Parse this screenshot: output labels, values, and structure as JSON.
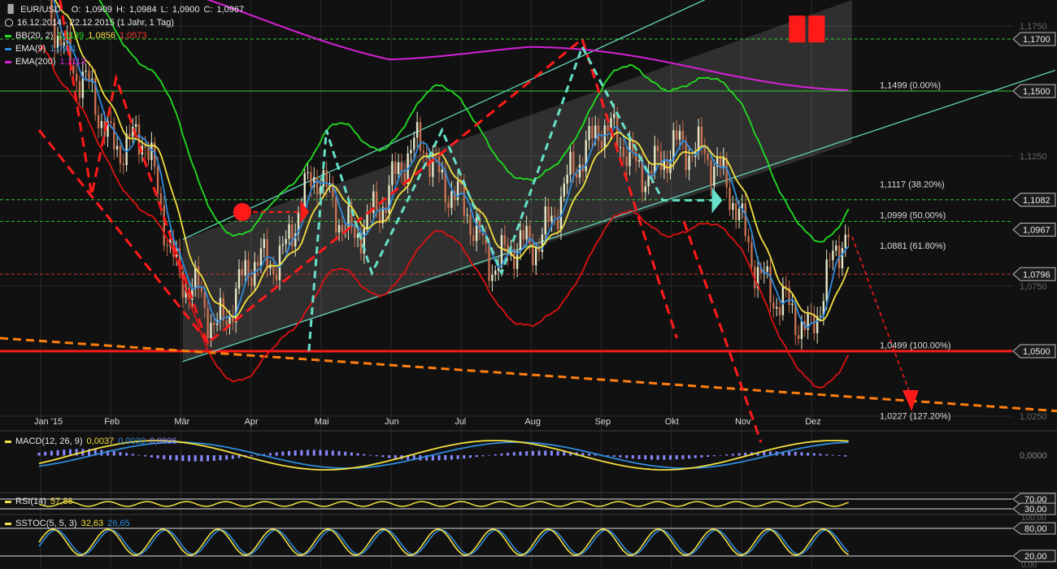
{
  "header": {
    "symbol": "EUR/USD",
    "ohlc": {
      "o_label": "O:",
      "o": "1,0909",
      "h_label": "H:",
      "h": "1,0984",
      "l_label": "L:",
      "l": "1,0900",
      "c_label": "C:",
      "c": "1,0967"
    },
    "range": "16.12.2014 - 22.12.2015 (1 Jahr, 1 Tag)",
    "bb": {
      "label": "BB(20, 2)",
      "v1": "1,1139",
      "v2": "1,0856",
      "v3": "1,0573"
    },
    "ema9": {
      "label": "EMA(9)",
      "value": "1,0911"
    },
    "ema200": {
      "label": "EMA(200)",
      "value": "1,1113"
    }
  },
  "colors": {
    "background": "#111111",
    "grid": "#2a2a2a",
    "text": "#dcdcdc",
    "bb_mid": "#22dd22",
    "bb_band": "#dd1111",
    "ema9": "#2e8bdc",
    "ema20": "#f2e040",
    "ema200": "#d620d6",
    "channel": "#66e0c8",
    "orange": "#ff7f0e",
    "candle_up": "#e8e8c8",
    "candle_down": "#c87050",
    "red_line": "#ff1a1a",
    "macd": "#f2e040",
    "signal": "#2e8bdc",
    "hist": "#8888ff"
  },
  "chart_data": {
    "type": "line",
    "title": "EUR/USD",
    "x_ticks": [
      "Jan '15",
      "Feb",
      "Mär",
      "Apr",
      "Mai",
      "Jun",
      "Jul",
      "Aug",
      "Sep",
      "Okt",
      "Nov",
      "Dez"
    ],
    "x_tick_months": [
      0,
      1,
      2,
      3,
      4,
      5,
      6,
      7,
      8,
      9,
      10,
      11
    ],
    "ylim": [
      1.02,
      1.185
    ],
    "y_ticks": [
      "1,1750",
      "1,1250",
      "1,0750",
      "1,0250"
    ],
    "y_tick_values": [
      1.175,
      1.125,
      1.075,
      1.025
    ],
    "price_labels": [
      {
        "text": "1,1700",
        "value": 1.17
      },
      {
        "text": "1,1500",
        "value": 1.15
      },
      {
        "text": "1,1082",
        "value": 1.1082
      },
      {
        "text": "1,0967",
        "value": 1.0967
      },
      {
        "text": "1,0796",
        "value": 1.0796
      },
      {
        "text": "1,0500",
        "value": 1.05
      }
    ],
    "fib_levels": [
      {
        "text": "1,1499 (0.00%)",
        "value": 1.1499
      },
      {
        "text": "1,1117 (38.20%)",
        "value": 1.1117
      },
      {
        "text": "1,0999 (50.00%)",
        "value": 1.0999
      },
      {
        "text": "1,0881 (61.80%)",
        "value": 1.0881
      },
      {
        "text": "1,0499 (100.00%)",
        "value": 1.0499
      },
      {
        "text": "1,0227 (127.20%)",
        "value": 1.0227
      }
    ],
    "monthly_close": {
      "x": [
        0,
        0.5,
        1,
        1.5,
        2,
        2.5,
        3,
        3.5,
        4,
        4.5,
        5,
        5.5,
        6,
        6.5,
        7,
        7.5,
        8,
        8.5,
        9,
        9.5,
        10,
        10.5,
        11,
        11.5
      ],
      "y": [
        1.19,
        1.16,
        1.132,
        1.13,
        1.08,
        1.06,
        1.08,
        1.09,
        1.12,
        1.09,
        1.115,
        1.13,
        1.105,
        1.085,
        1.09,
        1.11,
        1.14,
        1.12,
        1.125,
        1.13,
        1.1,
        1.068,
        1.06,
        1.094
      ]
    },
    "series": [
      {
        "name": "BB(20, 2)",
        "values": [
          "1,1139",
          "1,0856",
          "1,0573"
        ]
      },
      {
        "name": "EMA(9)",
        "values": [
          "1,0911"
        ]
      },
      {
        "name": "EMA(200)",
        "values": [
          "1,1113"
        ]
      }
    ],
    "indicators": {
      "macd": {
        "label": "MACD(12, 26, 9)",
        "v1": "0,0037",
        "v2": "0,0030",
        "v3": "0,0006",
        "y_tick": "0,0000"
      },
      "rsi": {
        "label": "RSI(14)",
        "value": "57,86",
        "levels": [
          "70,00",
          "30,00"
        ]
      },
      "sstoc": {
        "label": "SSTOC(5, 5, 3)",
        "v1": "32,63",
        "v2": "26,65",
        "levels": [
          "100,00",
          "80,00",
          "20,00",
          "0,00"
        ]
      }
    }
  }
}
